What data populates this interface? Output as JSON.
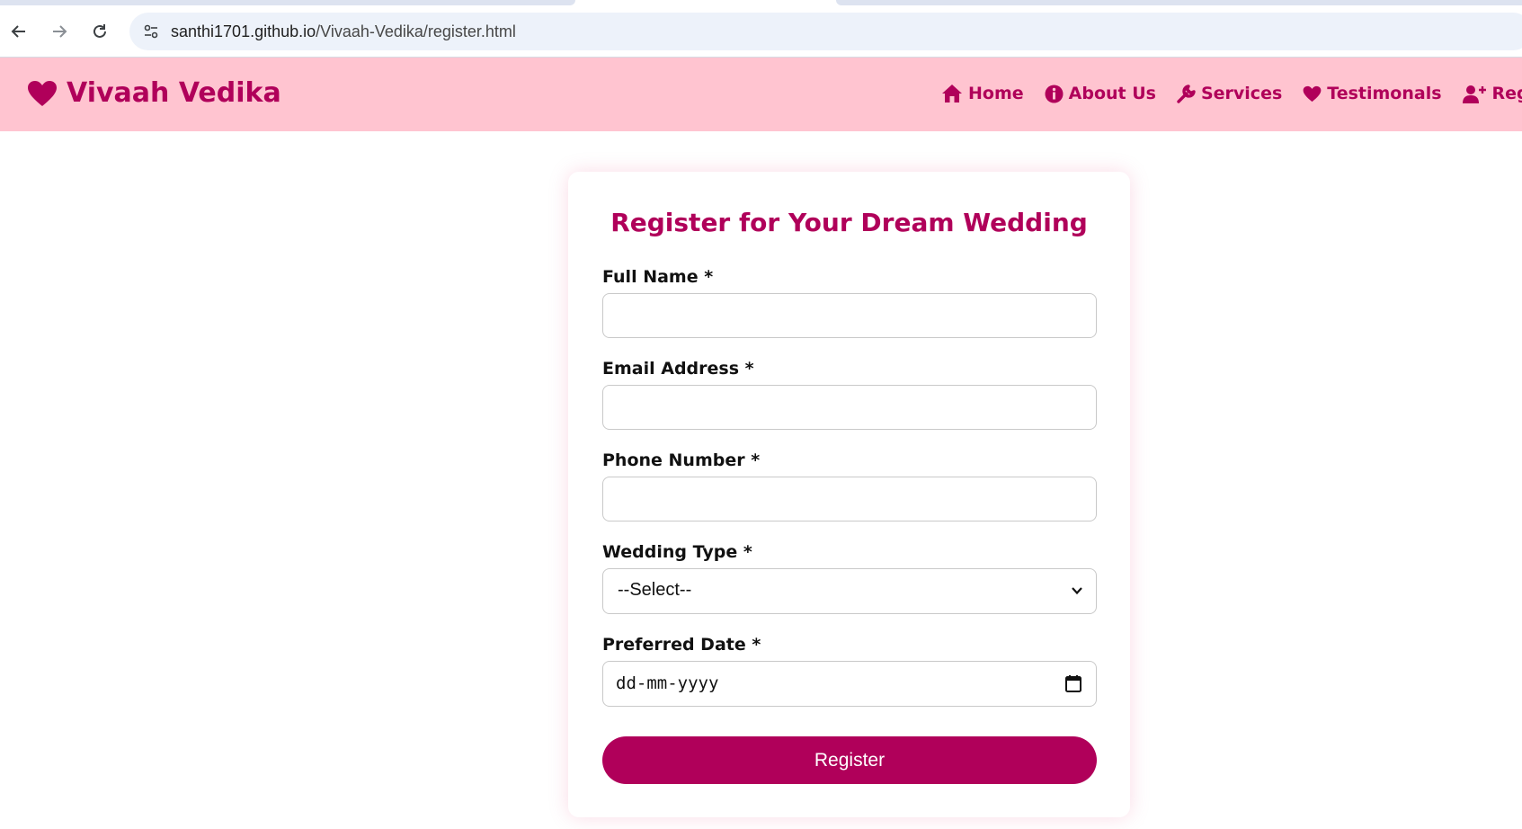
{
  "browser": {
    "url_host": "santhi1701.github.io",
    "url_path": "/Vivaah-Vedika/register.html"
  },
  "site": {
    "brand": "Vivaah Vedika",
    "brand_color": "#b0005a",
    "header_bg": "#ffc4d0",
    "nav": [
      {
        "label": "Home",
        "icon": "home-icon"
      },
      {
        "label": "About Us",
        "icon": "info-icon"
      },
      {
        "label": "Services",
        "icon": "wrench-icon"
      },
      {
        "label": "Testimonals",
        "icon": "heart-icon"
      },
      {
        "label": "Registra",
        "icon": "user-plus-icon"
      }
    ]
  },
  "form": {
    "title": "Register for Your Dream Wedding",
    "full_name_label": "Full Name *",
    "full_name_value": "",
    "email_label": "Email Address *",
    "email_value": "",
    "phone_label": "Phone Number *",
    "phone_value": "",
    "wedding_type_label": "Wedding Type *",
    "wedding_type_selected": "--Select--",
    "preferred_date_label": "Preferred Date *",
    "preferred_date_value": "dd-mm-yyyy",
    "submit_label": "Register"
  }
}
